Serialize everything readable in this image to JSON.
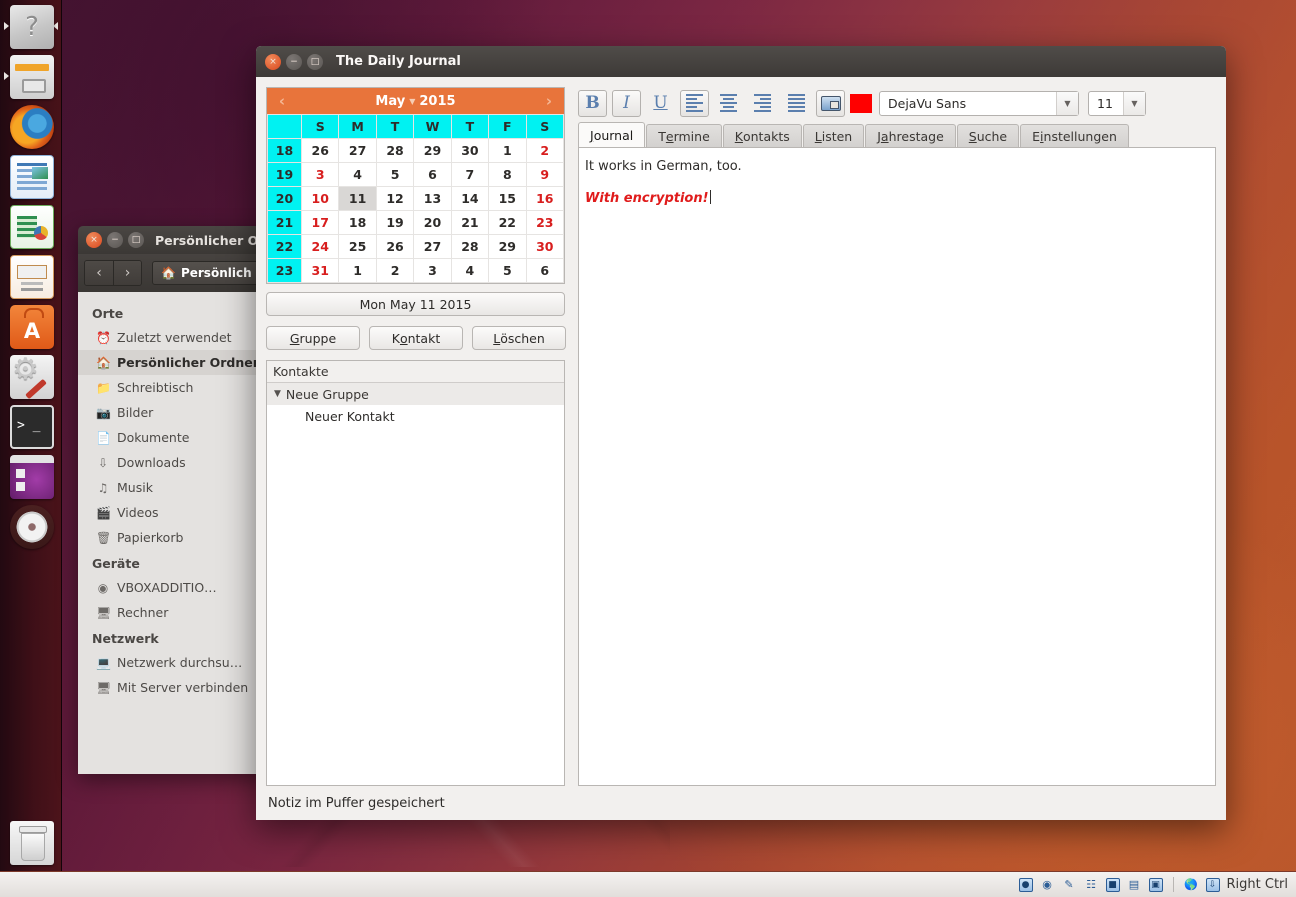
{
  "desktop": {
    "launcher_items": [
      {
        "name": "dash-home",
        "icon": "dash-icon",
        "pinned": true
      },
      {
        "name": "files",
        "icon": "files-icon",
        "pinned": true
      },
      {
        "name": "firefox",
        "icon": "firefox-icon",
        "pinned": false
      },
      {
        "name": "libreoffice-writer",
        "icon": "writer-icon",
        "pinned": false
      },
      {
        "name": "libreoffice-calc",
        "icon": "calc-icon",
        "pinned": false
      },
      {
        "name": "libreoffice-impress",
        "icon": "impress-icon",
        "pinned": false
      },
      {
        "name": "ubuntu-software-center",
        "icon": "software-center-icon",
        "pinned": false
      },
      {
        "name": "system-settings",
        "icon": "system-settings-icon",
        "pinned": false
      },
      {
        "name": "terminal",
        "icon": "terminal-icon",
        "pinned": false
      },
      {
        "name": "workspace-switcher",
        "icon": "workspace-switcher-icon",
        "pinned": false
      },
      {
        "name": "disk-image",
        "icon": "cd-icon",
        "pinned": false
      },
      {
        "name": "trash",
        "icon": "trash-icon",
        "pinned": false
      }
    ]
  },
  "file_manager": {
    "title": "Persönlicher O",
    "breadcrumb": "Persönlich",
    "nav": {
      "back": "‹",
      "forward": "›"
    },
    "sections": [
      {
        "heading": "Orte",
        "items": [
          {
            "label": "Zuletzt verwendet",
            "icon": "clock-icon",
            "selected": false
          },
          {
            "label": "Persönlicher Ordner",
            "icon": "home-icon",
            "selected": true
          },
          {
            "label": "Schreibtisch",
            "icon": "folder-icon",
            "selected": false
          },
          {
            "label": "Bilder",
            "icon": "camera-icon",
            "selected": false
          },
          {
            "label": "Dokumente",
            "icon": "document-icon",
            "selected": false
          },
          {
            "label": "Downloads",
            "icon": "download-icon",
            "selected": false
          },
          {
            "label": "Musik",
            "icon": "music-icon",
            "selected": false
          },
          {
            "label": "Videos",
            "icon": "video-icon",
            "selected": false
          },
          {
            "label": "Papierkorb",
            "icon": "trash-icon",
            "selected": false
          }
        ]
      },
      {
        "heading": "Geräte",
        "items": [
          {
            "label": "VBOXADDITIO…",
            "icon": "disc-icon",
            "selected": false,
            "eject": true
          },
          {
            "label": "Rechner",
            "icon": "computer-icon",
            "selected": false
          }
        ]
      },
      {
        "heading": "Netzwerk",
        "items": [
          {
            "label": "Netzwerk durchsu…",
            "icon": "network-icon",
            "selected": false
          },
          {
            "label": "Mit Server verbinden",
            "icon": "server-icon",
            "selected": false
          }
        ]
      }
    ]
  },
  "journal": {
    "title": "The Daily Journal",
    "window_buttons": {
      "close": "×",
      "minimize": "−",
      "maximize": "□"
    },
    "calendar": {
      "month": "May",
      "year": "2015",
      "prev_arrow": "‹",
      "next_arrow": "›",
      "month_dropdown": "▼",
      "week_col_header": "",
      "weekdays": [
        "S",
        "M",
        "T",
        "W",
        "T",
        "F",
        "S"
      ],
      "weeks": [
        {
          "number": "18",
          "days": [
            {
              "d": "26",
              "type": "other"
            },
            {
              "d": "27",
              "type": "other"
            },
            {
              "d": "28",
              "type": "other"
            },
            {
              "d": "29",
              "type": "other"
            },
            {
              "d": "30",
              "type": "other"
            },
            {
              "d": "1",
              "type": "day"
            },
            {
              "d": "2",
              "type": "sat"
            }
          ]
        },
        {
          "number": "19",
          "days": [
            {
              "d": "3",
              "type": "sun"
            },
            {
              "d": "4",
              "type": "day"
            },
            {
              "d": "5",
              "type": "day"
            },
            {
              "d": "6",
              "type": "day"
            },
            {
              "d": "7",
              "type": "day"
            },
            {
              "d": "8",
              "type": "day"
            },
            {
              "d": "9",
              "type": "sat"
            }
          ]
        },
        {
          "number": "20",
          "days": [
            {
              "d": "10",
              "type": "sun"
            },
            {
              "d": "11",
              "type": "today"
            },
            {
              "d": "12",
              "type": "day"
            },
            {
              "d": "13",
              "type": "day"
            },
            {
              "d": "14",
              "type": "day"
            },
            {
              "d": "15",
              "type": "day"
            },
            {
              "d": "16",
              "type": "sat"
            }
          ]
        },
        {
          "number": "21",
          "days": [
            {
              "d": "17",
              "type": "sun"
            },
            {
              "d": "18",
              "type": "day"
            },
            {
              "d": "19",
              "type": "day"
            },
            {
              "d": "20",
              "type": "day"
            },
            {
              "d": "21",
              "type": "day"
            },
            {
              "d": "22",
              "type": "day"
            },
            {
              "d": "23",
              "type": "sat"
            }
          ]
        },
        {
          "number": "22",
          "days": [
            {
              "d": "24",
              "type": "sun"
            },
            {
              "d": "25",
              "type": "day"
            },
            {
              "d": "26",
              "type": "day"
            },
            {
              "d": "27",
              "type": "day"
            },
            {
              "d": "28",
              "type": "day"
            },
            {
              "d": "29",
              "type": "day"
            },
            {
              "d": "30",
              "type": "sat"
            }
          ]
        },
        {
          "number": "23",
          "days": [
            {
              "d": "31",
              "type": "sun"
            },
            {
              "d": "1",
              "type": "other"
            },
            {
              "d": "2",
              "type": "other"
            },
            {
              "d": "3",
              "type": "other"
            },
            {
              "d": "4",
              "type": "other"
            },
            {
              "d": "5",
              "type": "other"
            },
            {
              "d": "6",
              "type": "other"
            }
          ]
        }
      ],
      "header_color": "#e8743b",
      "weekday_color": "#00f2f2",
      "weekend_text_color": "#d81e1e"
    },
    "selected_date_label": "Mon May 11 2015",
    "buttons": [
      {
        "label": "Gruppe",
        "mnemonic": "G"
      },
      {
        "label": "Kontakt",
        "mnemonic": "o"
      },
      {
        "label": "Löschen",
        "mnemonic": "L"
      }
    ],
    "contacts": {
      "header": "Kontakte",
      "group": {
        "label": "Neue Gruppe",
        "expanded": true,
        "expander": "▼"
      },
      "items": [
        "Neuer Kontakt"
      ]
    },
    "format_toolbar": {
      "bold": "B",
      "italic": "I",
      "underline": "U",
      "align_left": "align-left-icon",
      "align_center": "align-center-icon",
      "align_right": "align-right-icon",
      "justify": "justify-icon",
      "insert_image": "insert-image-icon",
      "color_swatch": "#FF0000",
      "font_family": "DejaVu Sans",
      "font_size": "11",
      "dropdown_arrow": "▼"
    },
    "tabs": [
      {
        "label": "Journal",
        "mnemonic": "J",
        "active": true
      },
      {
        "label": "Termine",
        "mnemonic": "e",
        "active": false
      },
      {
        "label": "Kontakts",
        "mnemonic": "K",
        "active": false
      },
      {
        "label": "Listen",
        "mnemonic": "L",
        "active": false
      },
      {
        "label": "Jahrestage",
        "mnemonic": "a",
        "active": false
      },
      {
        "label": "Suche",
        "mnemonic": "S",
        "active": false
      },
      {
        "label": "Einstellungen",
        "mnemonic": "i",
        "active": false
      }
    ],
    "editor": {
      "line1": "It works in German, too.",
      "line2": "With encryption!",
      "line2_color": "#e01b1b"
    },
    "status": "Notiz im Puffer gespeichert"
  },
  "vbox_status": {
    "icons": [
      "hard-disk-icon",
      "optical-disk-icon",
      "pen-icon",
      "network-icon",
      "folder-icon",
      "display-icon",
      "cpu-icon"
    ],
    "extra_icons": [
      "globe-icon",
      "download-icon"
    ],
    "host_key": "Right Ctrl"
  }
}
